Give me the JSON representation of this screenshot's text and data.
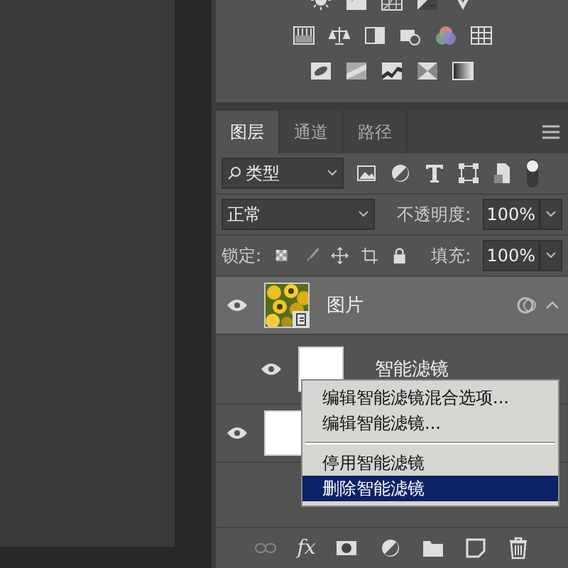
{
  "tabs": [
    {
      "label": "图层",
      "selected": true
    },
    {
      "label": "通道",
      "selected": false
    },
    {
      "label": "路径",
      "selected": false
    }
  ],
  "filter": {
    "value": "类型"
  },
  "blend": {
    "mode": "正常",
    "opacity_label": "不透明度:",
    "opacity": "100%"
  },
  "lock": {
    "label": "锁定:",
    "fill_label": "填充:",
    "fill": "100%"
  },
  "layers": [
    {
      "kind": "layer",
      "name": "图片",
      "visible": true,
      "selected": true,
      "expanded": true
    },
    {
      "kind": "filter",
      "name": "智能滤镜",
      "visible": true,
      "selected": false
    },
    {
      "kind": "layer",
      "visible": true,
      "selected": false,
      "thumbnail": {
        "kind": "blank"
      }
    }
  ],
  "context_menu": {
    "items": [
      {
        "label": "编辑智能滤镜混合选项...",
        "selected": false,
        "separator_before": false
      },
      {
        "label": "编辑智能滤镜...",
        "selected": false,
        "separator_before": false
      },
      {
        "label": "停用智能滤镜",
        "selected": false,
        "separator_before": true
      },
      {
        "label": "删除智能滤镜",
        "selected": true,
        "separator_before": false
      }
    ]
  },
  "toolbar": {
    "fx": "fx"
  }
}
